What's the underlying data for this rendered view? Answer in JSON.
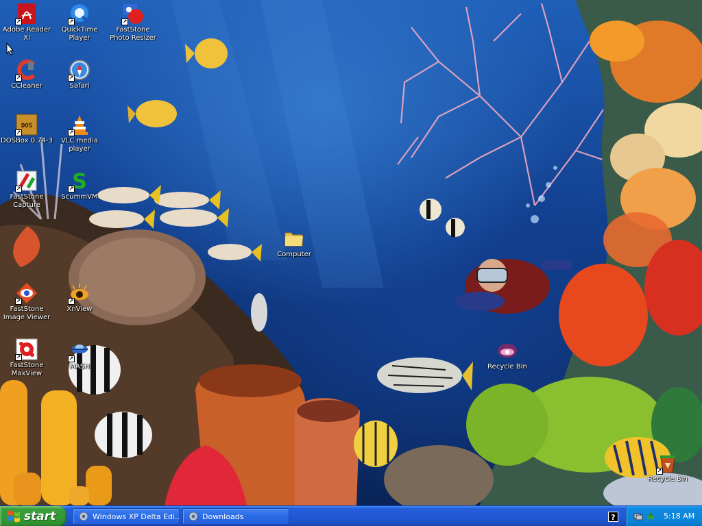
{
  "desktop": {
    "icons": [
      {
        "label": "Adobe Reader XI",
        "icon": "adobe-reader-icon"
      },
      {
        "label": "QuickTime Player",
        "icon": "quicktime-icon"
      },
      {
        "label": "FastStone Photo Resizer",
        "icon": "faststone-photo-resizer-icon"
      },
      {
        "label": "CCleaner",
        "icon": "ccleaner-icon"
      },
      {
        "label": "Safari",
        "icon": "safari-icon"
      },
      {
        "label": "DOSBox 0.74-3",
        "icon": "dosbox-icon"
      },
      {
        "label": "VLC media player",
        "icon": "vlc-icon"
      },
      {
        "label": "FastStone Capture",
        "icon": "faststone-capture-icon"
      },
      {
        "label": "ScummVM",
        "icon": "scummvm-icon"
      },
      {
        "label": "Computer",
        "icon": "folder-icon"
      },
      {
        "label": "FastStone Image Viewer",
        "icon": "faststone-image-viewer-icon"
      },
      {
        "label": "XnView",
        "icon": "xnview-icon"
      },
      {
        "label": "Recycle Bin",
        "icon": "clam-recycle-bin-icon"
      },
      {
        "label": "FastStone MaxView",
        "icon": "faststone-maxview-icon"
      },
      {
        "label": "MASH",
        "icon": "mash-icon"
      },
      {
        "label": "Recycle Bin",
        "icon": "recycle-bin-icon"
      }
    ]
  },
  "taskbar": {
    "start_label": "start",
    "buttons": [
      {
        "label": "Windows XP Delta Edi...",
        "icon": "window-icon"
      },
      {
        "label": "Downloads",
        "icon": "window-icon"
      }
    ],
    "help_label": "?",
    "clock": "5:18 AM"
  },
  "colors": {
    "taskbar_blue": "#245edb",
    "start_green": "#339933",
    "tray_blue": "#0e8ae0",
    "ocean_blue": "#1f5fb8"
  }
}
